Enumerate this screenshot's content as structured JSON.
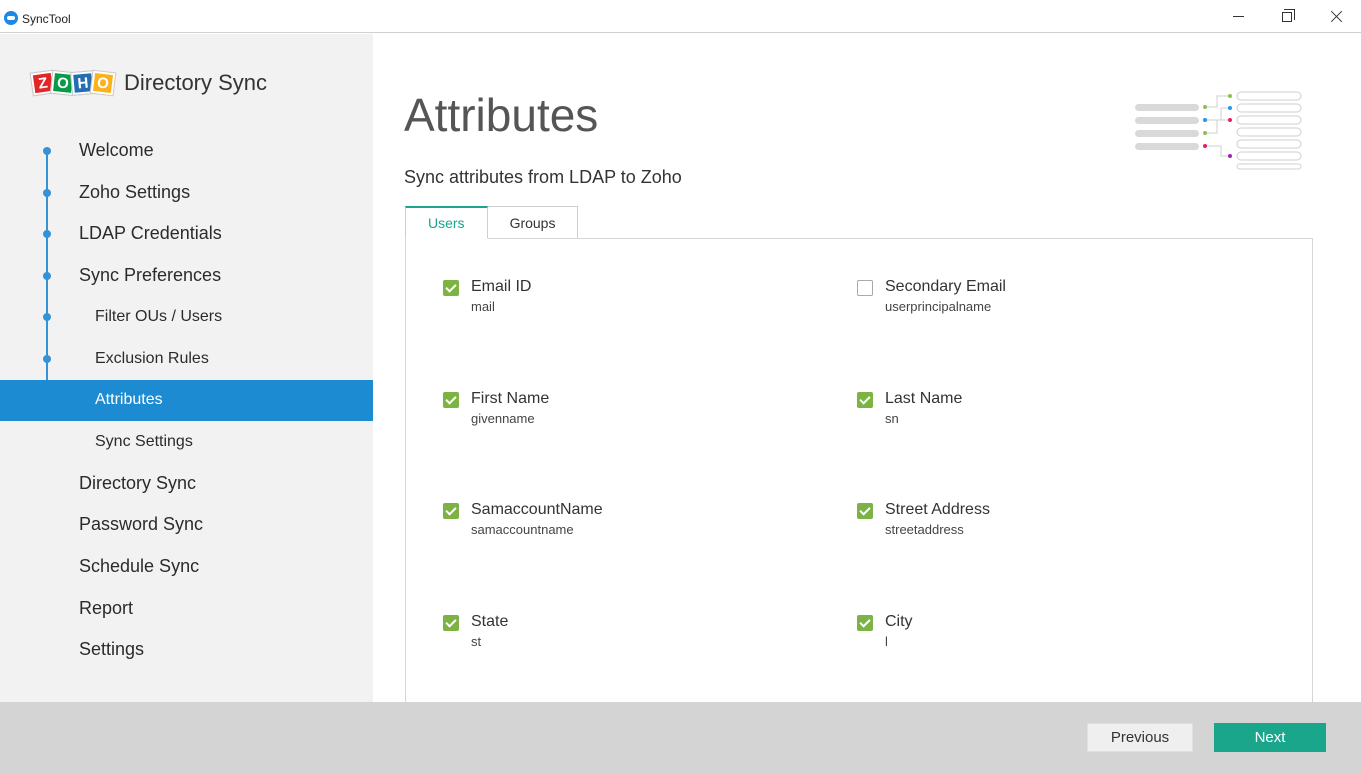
{
  "window": {
    "title": "SyncTool"
  },
  "logo": {
    "letters": [
      "Z",
      "O",
      "H",
      "O"
    ],
    "text": "Directory Sync"
  },
  "sidebar": {
    "items": [
      {
        "label": "Welcome",
        "level": "top"
      },
      {
        "label": "Zoho Settings",
        "level": "top"
      },
      {
        "label": "LDAP Credentials",
        "level": "top"
      },
      {
        "label": "Sync Preferences",
        "level": "top"
      },
      {
        "label": "Filter OUs / Users",
        "level": "sub"
      },
      {
        "label": "Exclusion Rules",
        "level": "sub"
      },
      {
        "label": "Attributes",
        "level": "sub",
        "active": true
      },
      {
        "label": "Sync Settings",
        "level": "sub"
      },
      {
        "label": "Directory Sync",
        "level": "top"
      },
      {
        "label": "Password Sync",
        "level": "top"
      },
      {
        "label": "Schedule Sync",
        "level": "top"
      },
      {
        "label": "Report",
        "level": "top"
      },
      {
        "label": "Settings",
        "level": "top"
      }
    ]
  },
  "main": {
    "title": "Attributes",
    "subtitle": "Sync attributes from LDAP to Zoho",
    "tabs": [
      {
        "label": "Users",
        "active": true
      },
      {
        "label": "Groups",
        "active": false
      }
    ],
    "attributes": [
      {
        "name": "Email ID",
        "key": "mail",
        "checked": true
      },
      {
        "name": "Secondary Email",
        "key": "userprincipalname",
        "checked": false
      },
      {
        "name": "First Name",
        "key": "givenname",
        "checked": true
      },
      {
        "name": "Last Name",
        "key": "sn",
        "checked": true
      },
      {
        "name": "SamaccountName",
        "key": "samaccountname",
        "checked": true
      },
      {
        "name": "Street Address",
        "key": "streetaddress",
        "checked": true
      },
      {
        "name": "State",
        "key": "st",
        "checked": true
      },
      {
        "name": "City",
        "key": "l",
        "checked": true
      }
    ]
  },
  "footer": {
    "previous_label": "Previous",
    "next_label": "Next"
  },
  "colors": {
    "accent": "#19a68a",
    "active_nav": "#1c8bd1",
    "checkbox": "#7cb342",
    "timeline": "#3592d6"
  }
}
